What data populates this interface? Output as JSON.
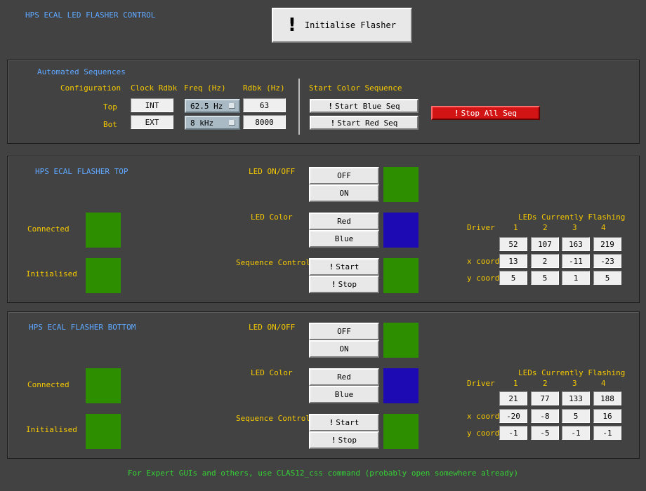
{
  "app_title": "HPS ECAL LED FLASHER CONTROL",
  "init_button": {
    "icon_glyph": "!",
    "label": "Initialise Flasher"
  },
  "seq": {
    "title": "Automated Sequences",
    "headers": {
      "config": "Configuration",
      "clock": "Clock Rdbk",
      "freq": "Freq (Hz)",
      "rdbk": "Rdbk (Hz)",
      "start_color": "Start Color Sequence"
    },
    "top": {
      "label": "Top",
      "clock": "INT",
      "freq": "62.5 Hz",
      "rdbk": "63"
    },
    "bot": {
      "label": "Bot",
      "clock": "EXT",
      "freq": "8 kHz",
      "rdbk": "8000"
    },
    "start_blue": "Start Blue Seq",
    "start_red": "Start Red Seq",
    "stop_all": "Stop All Seq",
    "bang": "!"
  },
  "labels": {
    "led_onoff": "LED ON/OFF",
    "off": "OFF",
    "on": "ON",
    "led_color": "LED Color",
    "red": "Red",
    "blue": "Blue",
    "seq_control": "Sequence Control",
    "start": "Start",
    "stop": "Stop",
    "connected": "Connected",
    "initialised": "Initialised",
    "leds_flashing": "LEDs Currently Flashing",
    "driver": "Driver",
    "x_coord": "x coord",
    "y_coord": "y coord",
    "bang": "!"
  },
  "driver_numbers": [
    "1",
    "2",
    "3",
    "4"
  ],
  "flasher_top": {
    "title": "HPS ECAL FLASHER TOP",
    "led_ids": [
      "52",
      "107",
      "163",
      "219"
    ],
    "x": [
      "13",
      "2",
      "-11",
      "-23"
    ],
    "y": [
      "5",
      "5",
      "1",
      "5"
    ]
  },
  "flasher_bottom": {
    "title": "HPS ECAL FLASHER BOTTOM",
    "led_ids": [
      "21",
      "77",
      "133",
      "188"
    ],
    "x": [
      "-20",
      "-8",
      "5",
      "16"
    ],
    "y": [
      "-1",
      "-5",
      "-1",
      "-1"
    ]
  },
  "footer": "For Expert GUIs and others, use CLAS12_css command (probably open somewhere already)",
  "colors": {
    "background": "#424242",
    "label_blue": "#5fa8ff",
    "label_yellow": "#f5c800",
    "footer_green": "#35d035",
    "indicator_green": "#2d8e00",
    "indicator_blue": "#1e0ab3",
    "stop_red": "#d21414"
  }
}
